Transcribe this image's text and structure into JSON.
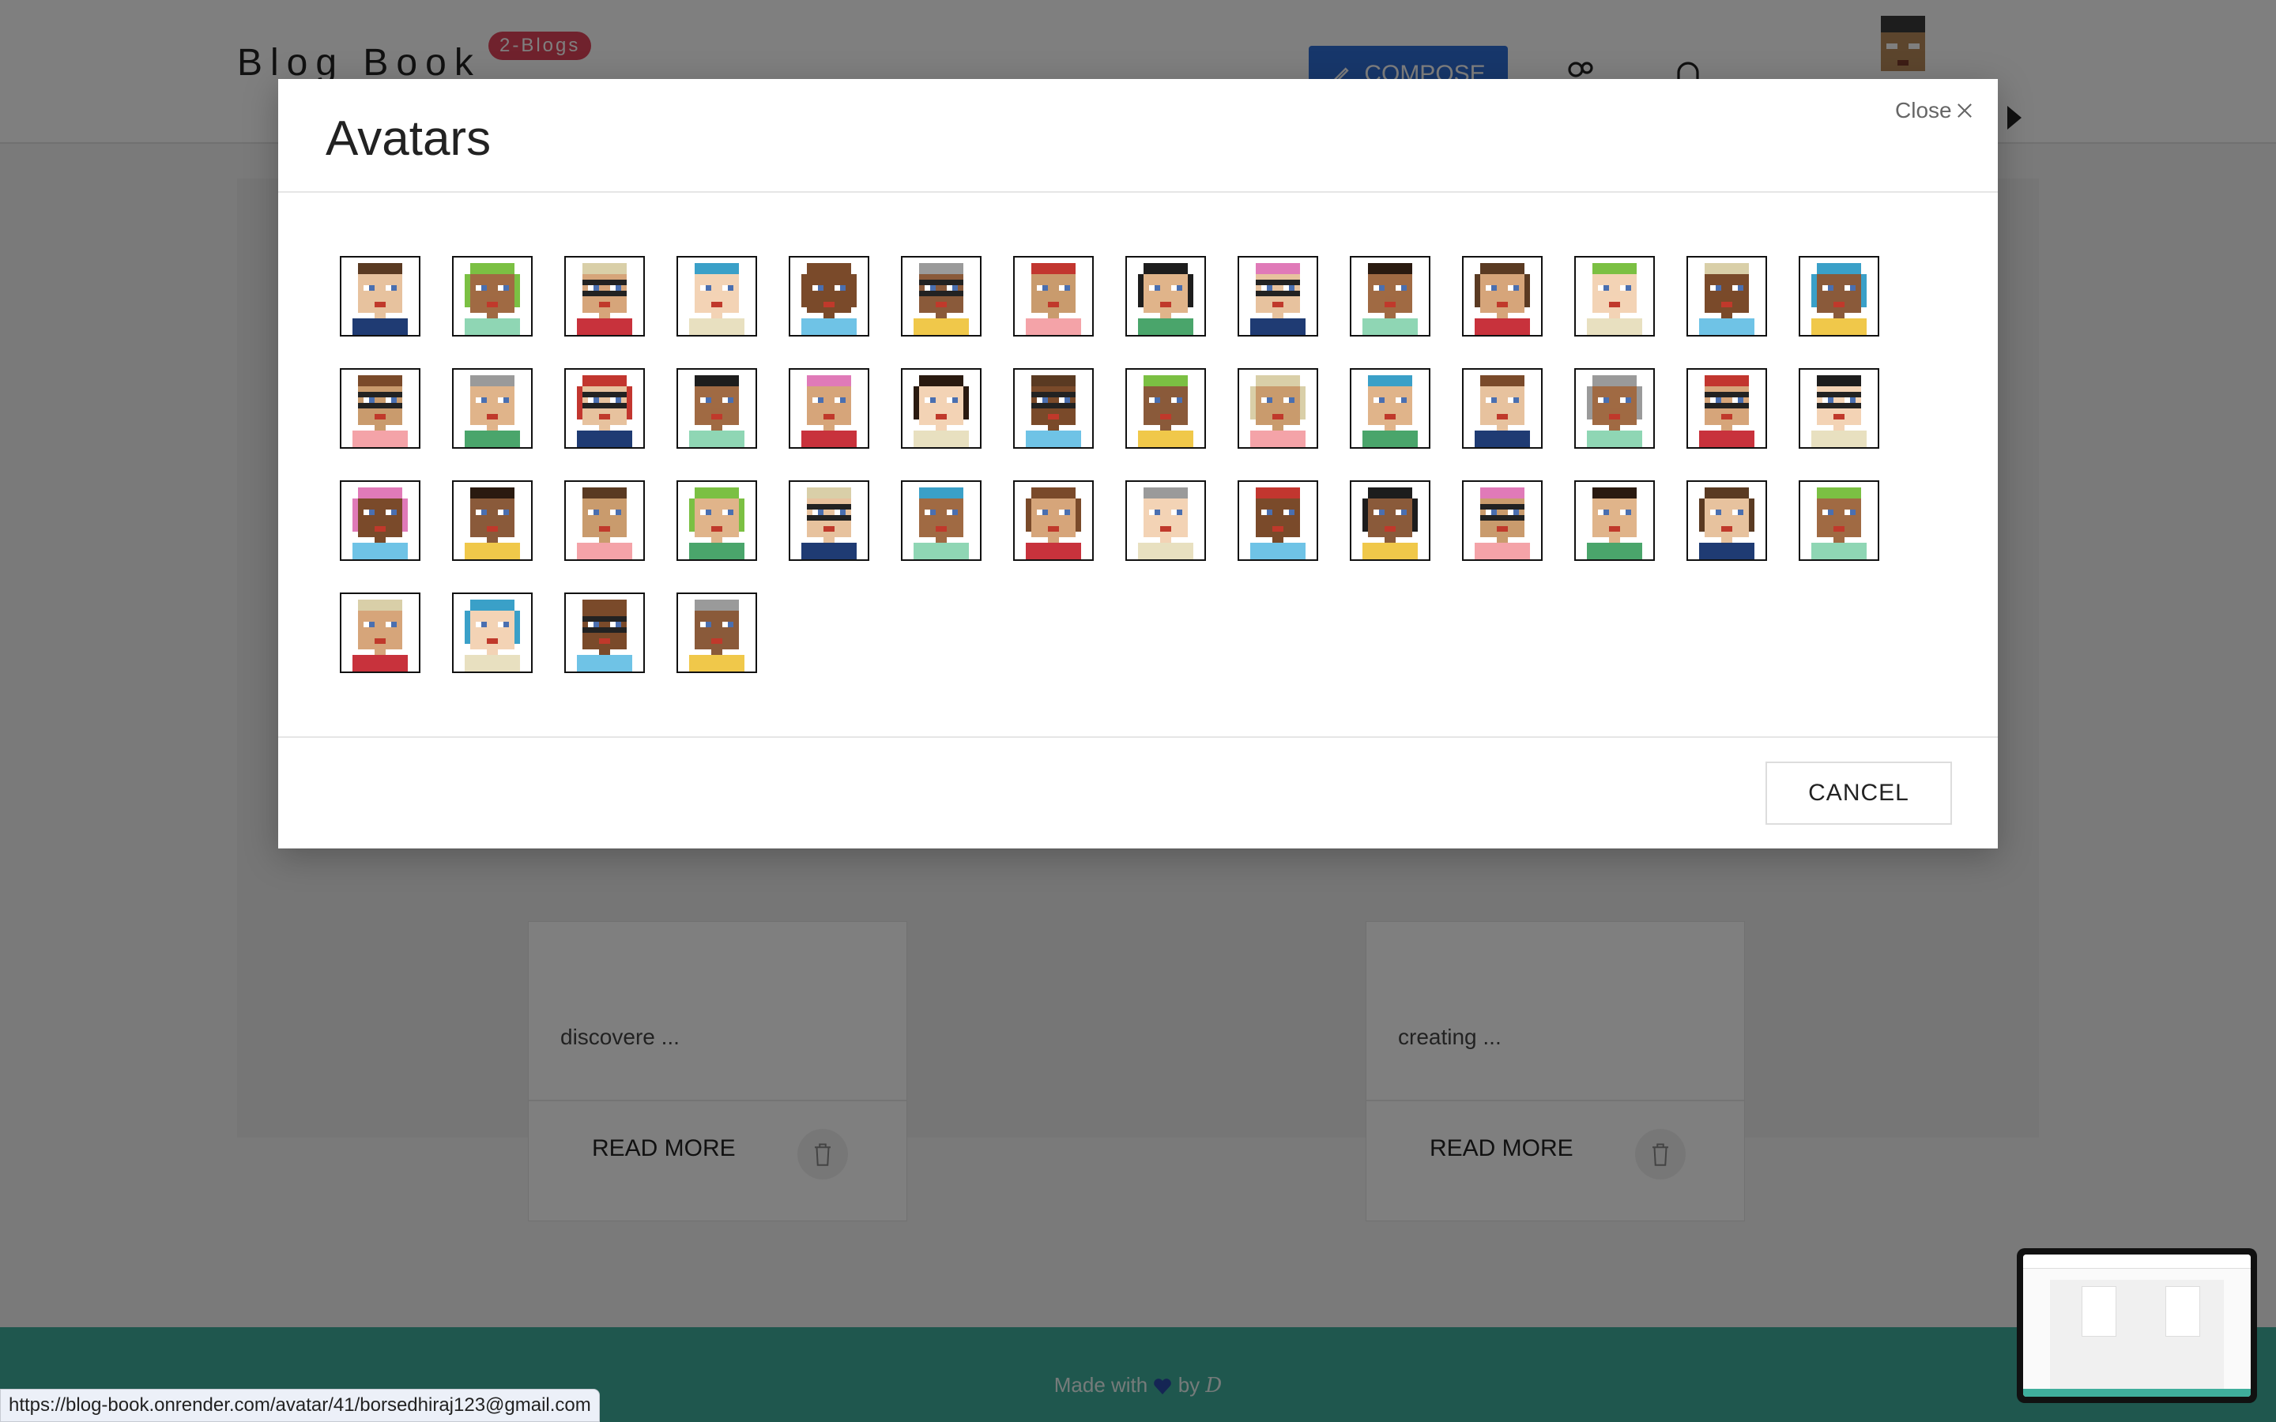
{
  "navbar": {
    "brand": "Blog Book",
    "badge": "2-Blogs",
    "compose_label": "COMPOSE"
  },
  "cards": [
    {
      "excerpt": "discovere ...",
      "read_more": "READ MORE"
    },
    {
      "excerpt": "creating ...",
      "read_more": "READ MORE"
    }
  ],
  "footer": {
    "made_with": "Made with",
    "by": "by",
    "logo": "D"
  },
  "modal": {
    "title": "Avatars",
    "close_label": "Close",
    "cancel_label": "CANCEL",
    "avatar_count": 46
  },
  "status_bar": {
    "url": "https://blog-book.onrender.com/avatar/41/borsedhiraj123@gmail.com"
  },
  "colors": {
    "accent": "#2f6fd6",
    "badge": "#e0455a",
    "footer": "#3fae9c"
  }
}
